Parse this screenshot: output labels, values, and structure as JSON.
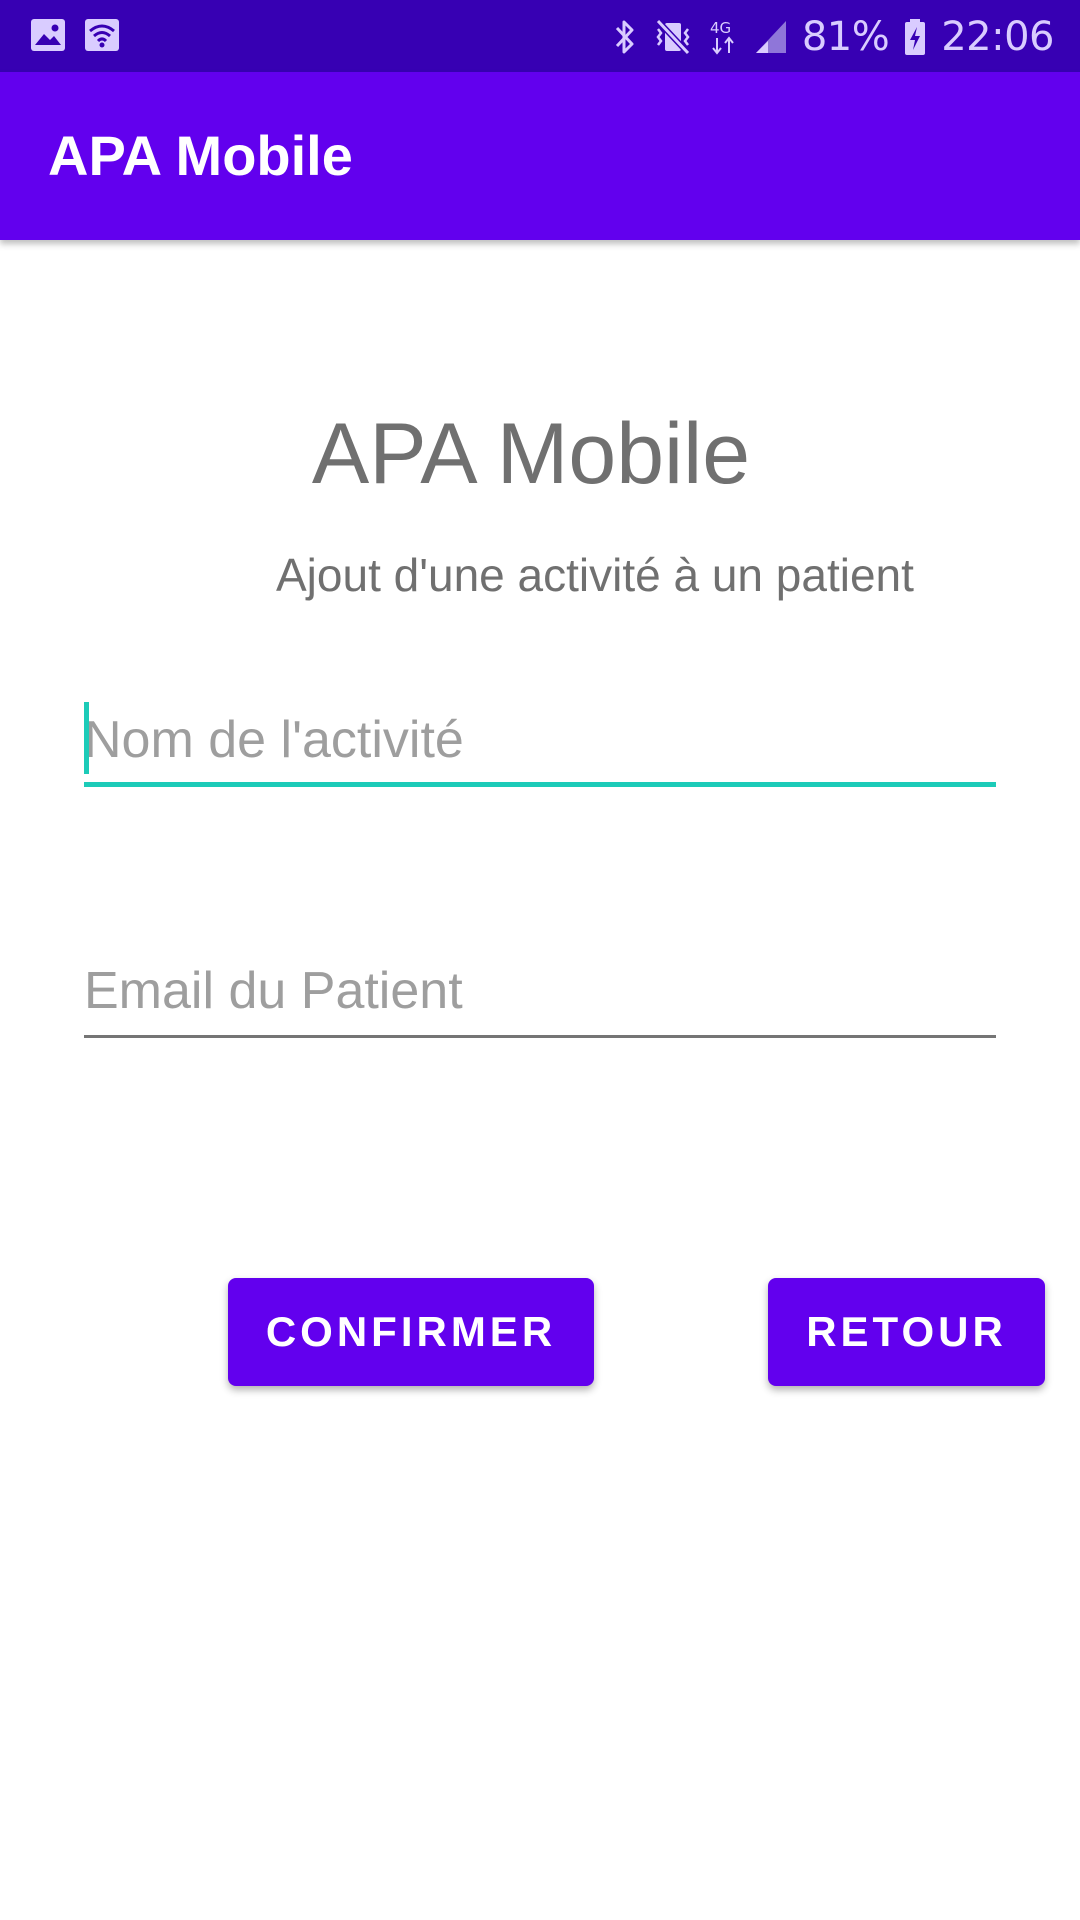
{
  "status_bar": {
    "left_icons": [
      "image-icon",
      "wifi-icon"
    ],
    "right_icons": [
      "bluetooth-icon",
      "vibrate-mute-icon",
      "network-4g-icon",
      "signal-icon",
      "battery-charging-icon"
    ],
    "battery": "81%",
    "time": "22:06",
    "network": "4G"
  },
  "app_bar": {
    "title": "APA Mobile"
  },
  "main": {
    "heading": "APA Mobile",
    "subheading": "Ajout d'une activité à un patient",
    "activity_name": {
      "value": "",
      "placeholder": "Nom de l'activité"
    },
    "patient_email": {
      "value": "",
      "placeholder": "Email du Patient"
    },
    "confirm_label": "CONFIRMER",
    "back_label": "RETOUR"
  },
  "colors": {
    "status_bar": "#3700B3",
    "primary": "#6200EE",
    "accent": "#1ccbb8",
    "text_secondary": "#707070"
  }
}
